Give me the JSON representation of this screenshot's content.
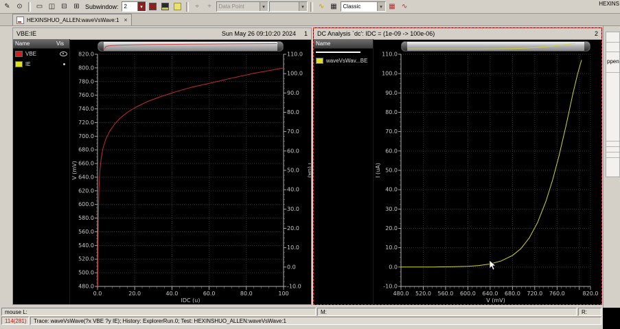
{
  "icons": {
    "pencil": "✎",
    "eye": "⊙",
    "single_window": "▭",
    "split_v": "◫",
    "split_h": "⊟",
    "quad": "⊞",
    "chevron_down": "▾",
    "pointer": "⌖",
    "crosshair": "+",
    "waveform": "∿",
    "calculator": "▦",
    "close": "×"
  },
  "toolbar": {
    "subwindow_label": "Subwindow:",
    "subwindow_value": "2",
    "datapoint_label": "Data Point",
    "style_value": "Classic"
  },
  "tab": {
    "title": "HEXINSHUO_ALLEN:waveVsWave:1"
  },
  "side": {
    "top_text": "HEXINS",
    "strip_text": "ppen"
  },
  "left_panel": {
    "title": "VBE:IE",
    "timestamp": "Sun May 26 09:10:20 2024",
    "index": "1",
    "legend": {
      "columns": [
        "Name",
        "Vis"
      ],
      "items": [
        {
          "name": "VBE",
          "color": "#e01818"
        },
        {
          "name": "IE",
          "color": "#e0e018"
        }
      ]
    }
  },
  "right_panel": {
    "title": "DC Analysis `dc': IDC = (1e-09 -> 100e-06)",
    "index": "2",
    "legend": {
      "columns": [
        "Name"
      ],
      "items": [
        {
          "name": "waveVsWav...BE",
          "color": "#e0e018"
        }
      ]
    }
  },
  "status": {
    "mouse_label": "mouse L:",
    "middle_label": "M:",
    "right_label": "R:",
    "position": "114(281)",
    "trace": "Trace: waveVsWave(?x VBE ?y IE); History: ExplorerRun.0; Test: HEXINSHUO_ALLEN:waveVsWave:1"
  },
  "chart_data": [
    {
      "type": "line",
      "title": "VBE:IE",
      "xlabel": "IDC (u)",
      "ylabel": "V (mV)",
      "y2label": "I (uA)",
      "xlim": [
        0,
        100
      ],
      "ylim": [
        480,
        820
      ],
      "y2lim": [
        -10,
        110
      ],
      "grid": true,
      "xticks": [
        [
          0,
          "0.0"
        ],
        [
          20,
          "20.0"
        ],
        [
          40,
          "40.0"
        ],
        [
          60,
          "60.0"
        ],
        [
          80,
          "80.0"
        ],
        [
          100,
          "100"
        ]
      ],
      "yticks": [
        [
          480,
          "480.0"
        ],
        [
          500,
          "500.0"
        ],
        [
          520,
          "520.0"
        ],
        [
          540,
          "540.0"
        ],
        [
          560,
          "560.0"
        ],
        [
          580,
          "580.0"
        ],
        [
          600,
          "600.0"
        ],
        [
          620,
          "620.0"
        ],
        [
          640,
          "640.0"
        ],
        [
          660,
          "660.0"
        ],
        [
          680,
          "680.0"
        ],
        [
          700,
          "700.0"
        ],
        [
          720,
          "720.0"
        ],
        [
          740,
          "740.0"
        ],
        [
          760,
          "760.0"
        ],
        [
          780,
          "780.0"
        ],
        [
          800,
          "800.0"
        ],
        [
          820,
          "820.0"
        ]
      ],
      "y2ticks": [
        [
          -10,
          "-10.0"
        ],
        [
          0,
          "0.0"
        ],
        [
          10,
          "10.0"
        ],
        [
          20,
          "20.0"
        ],
        [
          30,
          "30.0"
        ],
        [
          40,
          "40.0"
        ],
        [
          50,
          "50.0"
        ],
        [
          60,
          "60.0"
        ],
        [
          70,
          "70.0"
        ],
        [
          80,
          "80.0"
        ],
        [
          90,
          "90.0"
        ],
        [
          100,
          "100.0"
        ],
        [
          110,
          "110.0"
        ]
      ],
      "series": [
        {
          "name": "VBE",
          "color": "#c22f2f",
          "axis": "left",
          "points": [
            [
              0.15,
              480
            ],
            [
              0.3,
              545
            ],
            [
              0.5,
              592
            ],
            [
              0.8,
              625
            ],
            [
              1.2,
              648
            ],
            [
              2,
              668
            ],
            [
              3,
              683
            ],
            [
              4.5,
              696
            ],
            [
              6.5,
              707
            ],
            [
              9,
              717
            ],
            [
              12,
              726
            ],
            [
              16,
              735
            ],
            [
              21,
              743
            ],
            [
              27,
              751
            ],
            [
              34,
              758
            ],
            [
              42,
              765
            ],
            [
              51,
              772
            ],
            [
              61,
              778
            ],
            [
              72,
              785
            ],
            [
              84,
              792
            ],
            [
              100,
              800
            ]
          ]
        }
      ]
    },
    {
      "type": "line",
      "title": "DC Analysis `dc': IDC = (1e-09 -> 100e-06)",
      "xlabel": "V (mV)",
      "ylabel": "I (uA)",
      "xlim": [
        480,
        820
      ],
      "ylim": [
        -10,
        110
      ],
      "grid": true,
      "xticks": [
        [
          480,
          "480.0"
        ],
        [
          520,
          "520.0"
        ],
        [
          560,
          "560.0"
        ],
        [
          600,
          "600.0"
        ],
        [
          640,
          "640.0"
        ],
        [
          680,
          "680.0"
        ],
        [
          720,
          "720.0"
        ],
        [
          760,
          "760.0"
        ],
        [
          800,
          ""
        ],
        [
          820,
          "820.0"
        ]
      ],
      "yticks": [
        [
          -10,
          "-10.0"
        ],
        [
          0,
          "0.0"
        ],
        [
          10,
          "10.0"
        ],
        [
          20,
          "20.0"
        ],
        [
          30,
          "30.0"
        ],
        [
          40,
          "40.0"
        ],
        [
          50,
          "50.0"
        ],
        [
          60,
          "60.0"
        ],
        [
          70,
          "70.0"
        ],
        [
          80,
          "80.0"
        ],
        [
          90,
          "90.0"
        ],
        [
          100,
          "100.0"
        ],
        [
          110,
          "110.0"
        ]
      ],
      "series": [
        {
          "name": "waveVsWav...BE",
          "color": "#d6d62a",
          "axis": "left",
          "points": [
            [
              480,
              0
            ],
            [
              510,
              0
            ],
            [
              540,
              0.05
            ],
            [
              570,
              0.15
            ],
            [
              600,
              0.4
            ],
            [
              620,
              0.8
            ],
            [
              640,
              1.6
            ],
            [
              660,
              3.2
            ],
            [
              680,
              6
            ],
            [
              695,
              9.5
            ],
            [
              710,
              15
            ],
            [
              725,
              23
            ],
            [
              740,
              34
            ],
            [
              752,
              45
            ],
            [
              764,
              58
            ],
            [
              776,
              73
            ],
            [
              788,
              89
            ],
            [
              797,
              100
            ],
            [
              804,
              107
            ]
          ]
        }
      ]
    }
  ]
}
